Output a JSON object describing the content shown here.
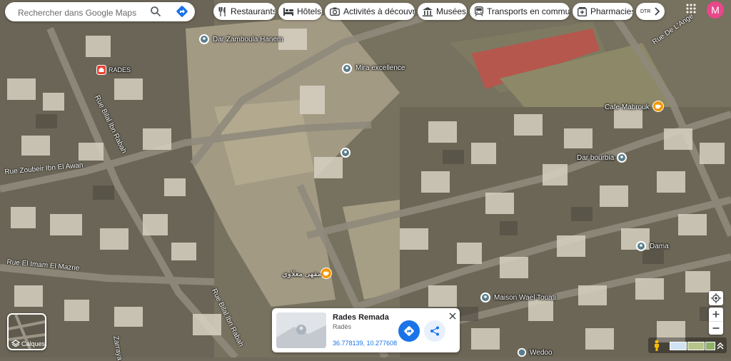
{
  "search": {
    "placeholder": "Rechercher dans Google Maps"
  },
  "chips": [
    {
      "label": "Restaurants",
      "icon": "fork-knife-icon"
    },
    {
      "label": "Hôtels",
      "icon": "bed-icon"
    },
    {
      "label": "Activités à découvrir",
      "icon": "camera-icon"
    },
    {
      "label": "Musées",
      "icon": "museum-icon"
    },
    {
      "label": "Transports en commun",
      "icon": "transit-icon"
    },
    {
      "label": "Pharmacies",
      "icon": "pharmacy-icon"
    },
    {
      "label": "DTR"
    }
  ],
  "account": {
    "initial": "M",
    "color": "#e8478a"
  },
  "places": [
    {
      "name": "Dar Zamboula Hanem"
    },
    {
      "name": "Mira excellence"
    },
    {
      "name": "RADES"
    },
    {
      "name": "Cafe Mabrouk"
    },
    {
      "name": "Dar bourbia"
    },
    {
      "name": "Dama"
    },
    {
      "name": "مقهى معلاوي"
    },
    {
      "name": "Maison Wael Touati"
    },
    {
      "name": "Wedoo"
    }
  ],
  "streets": [
    {
      "name": "Rue Bilal Ibn Rabah"
    },
    {
      "name": "Rue Zoubeir Ibn El Awan"
    },
    {
      "name": "Rue El Imam El Mazrie"
    },
    {
      "name": "Rue Bilal Ibn Rabah"
    },
    {
      "name": "Rue De L'Ange"
    },
    {
      "name": "Zarraya"
    }
  ],
  "layers": {
    "label": "Calques"
  },
  "card": {
    "title": "Rades Remada",
    "subtitle": "Radès",
    "coords": "36.778139, 10.277608"
  },
  "colors": {
    "accent": "#1a73e8",
    "directions": "#188038",
    "pin": "#ea4335",
    "cafe": "#f29900"
  }
}
